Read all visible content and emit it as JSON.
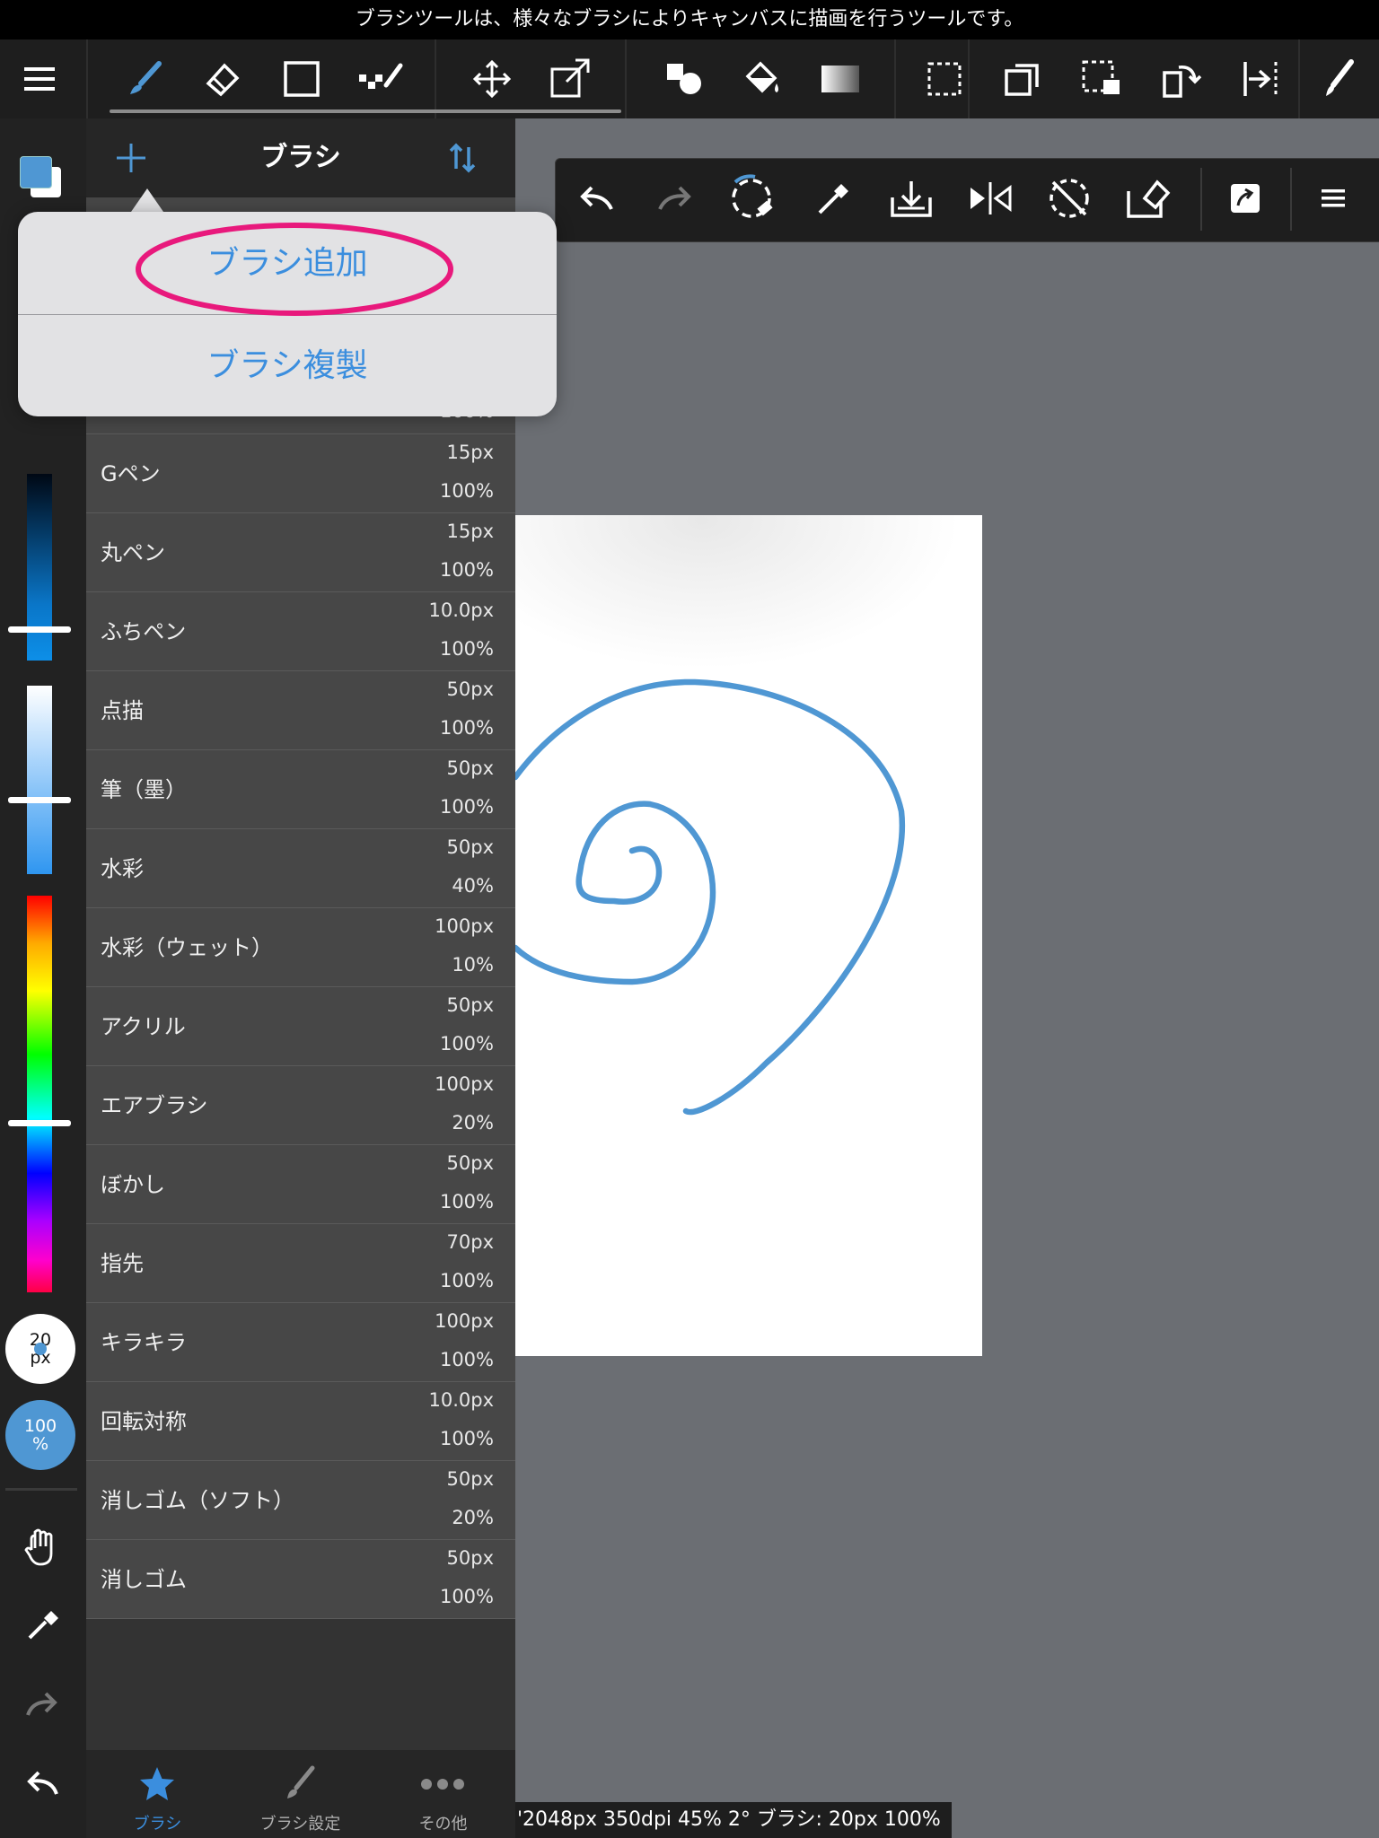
{
  "hint": "ブラシツールは、様々なブラシによりキャンバスに描画を行うツールです。",
  "toolbar": {
    "tools": [
      "menu-icon",
      "brush-tool-icon",
      "eraser-tool-icon",
      "shape-tool-icon",
      "dot-tool-icon",
      "move-tool-icon",
      "transform-tool-icon",
      "fill-shape-icon",
      "bucket-icon",
      "gradient-icon",
      "select-icon",
      "layer-copy-icon",
      "select-move-icon",
      "rotate-icon",
      "flip-icon",
      "pen-icon"
    ]
  },
  "panel": {
    "title": "ブラシ",
    "brushes": [
      {
        "name": "Gペン",
        "size": "15px",
        "opacity": "100%"
      },
      {
        "name": "丸ペン",
        "size": "15px",
        "opacity": "100%"
      },
      {
        "name": "ふちペン",
        "size": "10.0px",
        "opacity": "100%"
      },
      {
        "name": "点描",
        "size": "50px",
        "opacity": "100%"
      },
      {
        "name": "筆（墨）",
        "size": "50px",
        "opacity": "100%"
      },
      {
        "name": "水彩",
        "size": "50px",
        "opacity": "40%"
      },
      {
        "name": "水彩（ウェット）",
        "size": "100px",
        "opacity": "10%"
      },
      {
        "name": "アクリル",
        "size": "50px",
        "opacity": "100%"
      },
      {
        "name": "エアブラシ",
        "size": "100px",
        "opacity": "20%"
      },
      {
        "name": "ぼかし",
        "size": "50px",
        "opacity": "100%"
      },
      {
        "name": "指先",
        "size": "70px",
        "opacity": "100%"
      },
      {
        "name": "キラキラ",
        "size": "100px",
        "opacity": "100%"
      },
      {
        "name": "回転対称",
        "size": "10.0px",
        "opacity": "100%"
      },
      {
        "name": "消しゴム（ソフト）",
        "size": "50px",
        "opacity": "20%"
      },
      {
        "name": "消しゴム",
        "size": "50px",
        "opacity": "100%"
      }
    ],
    "partial_row": {
      "opacity": "100%"
    }
  },
  "popover": {
    "add": "ブラシ追加",
    "duplicate": "ブラシ複製"
  },
  "left": {
    "brush_size_top": "20",
    "brush_size_unit": "px",
    "opacity_value": "100",
    "opacity_unit": "%"
  },
  "tabs": [
    {
      "label": "ブラシ",
      "active": true
    },
    {
      "label": "ブラシ設定",
      "active": false
    },
    {
      "label": "その他",
      "active": false
    }
  ],
  "status": "'2048px 350dpi 45% 2° ブラシ: 20px 100%",
  "colors": {
    "accent": "#3b8ede",
    "stroke": "#4f97d3",
    "highlight": "#e8197c"
  }
}
